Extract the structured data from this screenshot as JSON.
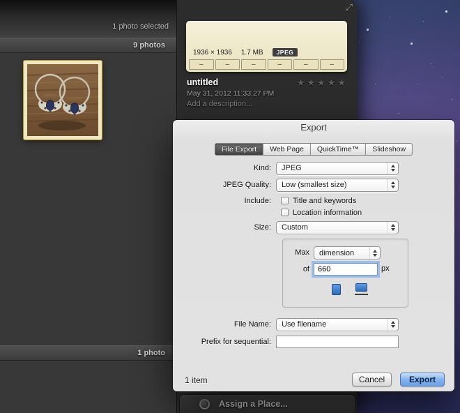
{
  "window": {
    "expand_icon": "⤢"
  },
  "left_pane": {
    "selected_status": "1 photo selected",
    "album_header": "9 photos",
    "lower_header": "1 photo"
  },
  "info_panel": {
    "film": {
      "dimensions": "1936 × 1936",
      "size": "1.7 MB",
      "format": "JPEG",
      "dashes": [
        "–",
        "–",
        "–",
        "–",
        "–",
        "–"
      ]
    },
    "title": "untitled",
    "date": "May 31, 2012 11:33:27 PM",
    "description": "Add a description...",
    "rating": "★★★★★",
    "assign_place": "Assign a Place..."
  },
  "dialog": {
    "title": "Export",
    "tabs": [
      {
        "label": "File Export"
      },
      {
        "label": "Web Page"
      },
      {
        "label": "QuickTime™"
      },
      {
        "label": "Slideshow"
      }
    ],
    "kind_label": "Kind:",
    "kind_value": "JPEG",
    "quality_label": "JPEG Quality:",
    "quality_value": "Low (smallest size)",
    "include_label": "Include:",
    "include_options": [
      {
        "label": "Title and keywords",
        "checked": false
      },
      {
        "label": "Location information",
        "checked": false
      }
    ],
    "size_label": "Size:",
    "size_value": "Custom",
    "max_label": "Max",
    "max_value": "dimension",
    "of_label": "of",
    "of_value": "660",
    "of_unit": "px",
    "file_name_label": "File Name:",
    "file_name_value": "Use filename",
    "prefix_label": "Prefix for sequential:",
    "prefix_value": "",
    "footer": {
      "count": "1 item",
      "cancel": "Cancel",
      "export": "Export"
    }
  },
  "colors": {
    "accent_blue": "#4f8fd6",
    "dialog_bg": "#e2e2e2",
    "focus_ring": "#73a5eb"
  }
}
